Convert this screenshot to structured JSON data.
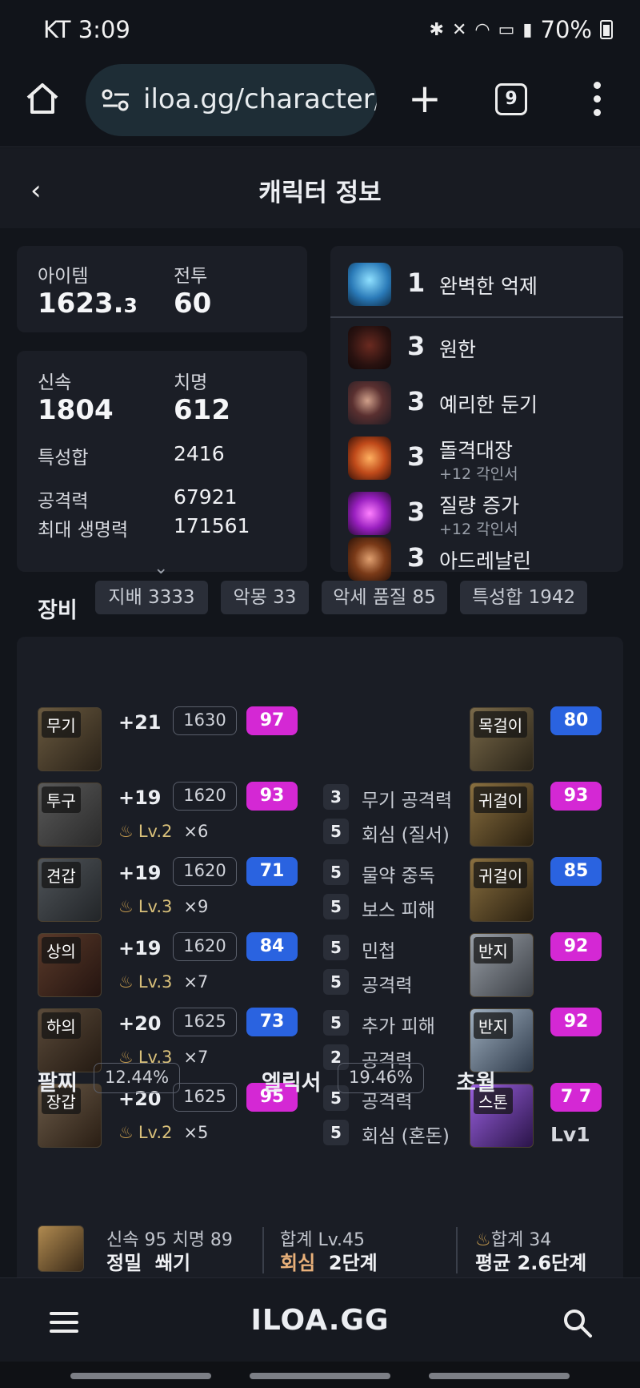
{
  "status": {
    "carrier": "KT",
    "time": "3:09",
    "battery": "70%"
  },
  "browser": {
    "url": "iloa.gg/character/",
    "tab_count": "9"
  },
  "page": {
    "title": "캐릭터 정보"
  },
  "stats1": {
    "item_label": "아이템",
    "item_main": "1623.",
    "item_dec": "3",
    "combat_label": "전투",
    "combat_value": "60"
  },
  "stats2": {
    "swift_label": "신속",
    "swift_value": "1804",
    "crit_label": "치명",
    "crit_value": "612",
    "trait_label": "특성합",
    "trait_value": "2416",
    "atk_label": "공격력",
    "atk_value": "67921",
    "hp_label": "최대 생명력",
    "hp_value": "171561"
  },
  "engravings": {
    "top": {
      "level": "1",
      "name": "완벽한 억제"
    },
    "items": [
      {
        "level": "3",
        "name": "원한",
        "sub": ""
      },
      {
        "level": "3",
        "name": "예리한 둔기",
        "sub": ""
      },
      {
        "level": "3",
        "name": "돌격대장",
        "sub": "+12 각인서"
      },
      {
        "level": "3",
        "name": "질량 증가",
        "sub": "+12 각인서"
      },
      {
        "level": "3",
        "name": "아드레날린",
        "sub": ""
      }
    ]
  },
  "equipment": {
    "title": "장비",
    "chips": [
      "지배 3333",
      "악몽 33",
      "악세 품질 85",
      "특성합 1942"
    ],
    "gear": [
      {
        "slot": "무기",
        "hone": "+21",
        "ilvl": "1630",
        "quality": "97",
        "lv": "",
        "mult": ""
      },
      {
        "slot": "투구",
        "hone": "+19",
        "ilvl": "1620",
        "quality": "93",
        "lv": "Lv.2",
        "mult": "×6"
      },
      {
        "slot": "견갑",
        "hone": "+19",
        "ilvl": "1620",
        "quality": "71",
        "lv": "Lv.3",
        "mult": "×9"
      },
      {
        "slot": "상의",
        "hone": "+19",
        "ilvl": "1620",
        "quality": "84",
        "lv": "Lv.3",
        "mult": "×7"
      },
      {
        "slot": "하의",
        "hone": "+20",
        "ilvl": "1625",
        "quality": "73",
        "lv": "Lv.3",
        "mult": "×7"
      },
      {
        "slot": "장갑",
        "hone": "+20",
        "ilvl": "1625",
        "quality": "95",
        "lv": "Lv.2",
        "mult": "×5"
      }
    ],
    "options": [
      {
        "n": "3",
        "t": "무기 공격력"
      },
      {
        "n": "5",
        "t": "회심 (질서)"
      },
      {
        "n": "5",
        "t": "물약 중독"
      },
      {
        "n": "5",
        "t": "보스 피해"
      },
      {
        "n": "5",
        "t": "민첩"
      },
      {
        "n": "5",
        "t": "공격력"
      },
      {
        "n": "5",
        "t": "추가 피해"
      },
      {
        "n": "2",
        "t": "공격력"
      },
      {
        "n": "5",
        "t": "공격력"
      },
      {
        "n": "5",
        "t": "회심 (혼돈)"
      }
    ],
    "accessories": [
      {
        "slot": "목걸이",
        "quality": "80"
      },
      {
        "slot": "귀걸이",
        "quality": "93"
      },
      {
        "slot": "귀걸이",
        "quality": "85"
      },
      {
        "slot": "반지",
        "quality": "92"
      },
      {
        "slot": "반지",
        "quality": "92"
      },
      {
        "slot": "스톤",
        "quality": "7 7",
        "extra": "Lv1"
      }
    ]
  },
  "bracelet": {
    "title": "팔찌",
    "pct": "12.44%",
    "line1": "신속 95  치명 89",
    "line2a": "정밀",
    "line2b": "쐐기"
  },
  "elixir": {
    "title": "엘릭서",
    "pct": "19.46%",
    "line1": "합계 Lv.45",
    "line2a": "회심",
    "line2b": "2단계"
  },
  "transcend": {
    "title": "초월",
    "line1": "합계 34",
    "line2": "평균 2.6단계"
  },
  "footer": {
    "logo": "ILOA.GG"
  },
  "colors": {
    "quality_pink": "#d428d4",
    "quality_blue": "#2a63e0",
    "bg": "#12151b",
    "card": "#1b1e26"
  }
}
